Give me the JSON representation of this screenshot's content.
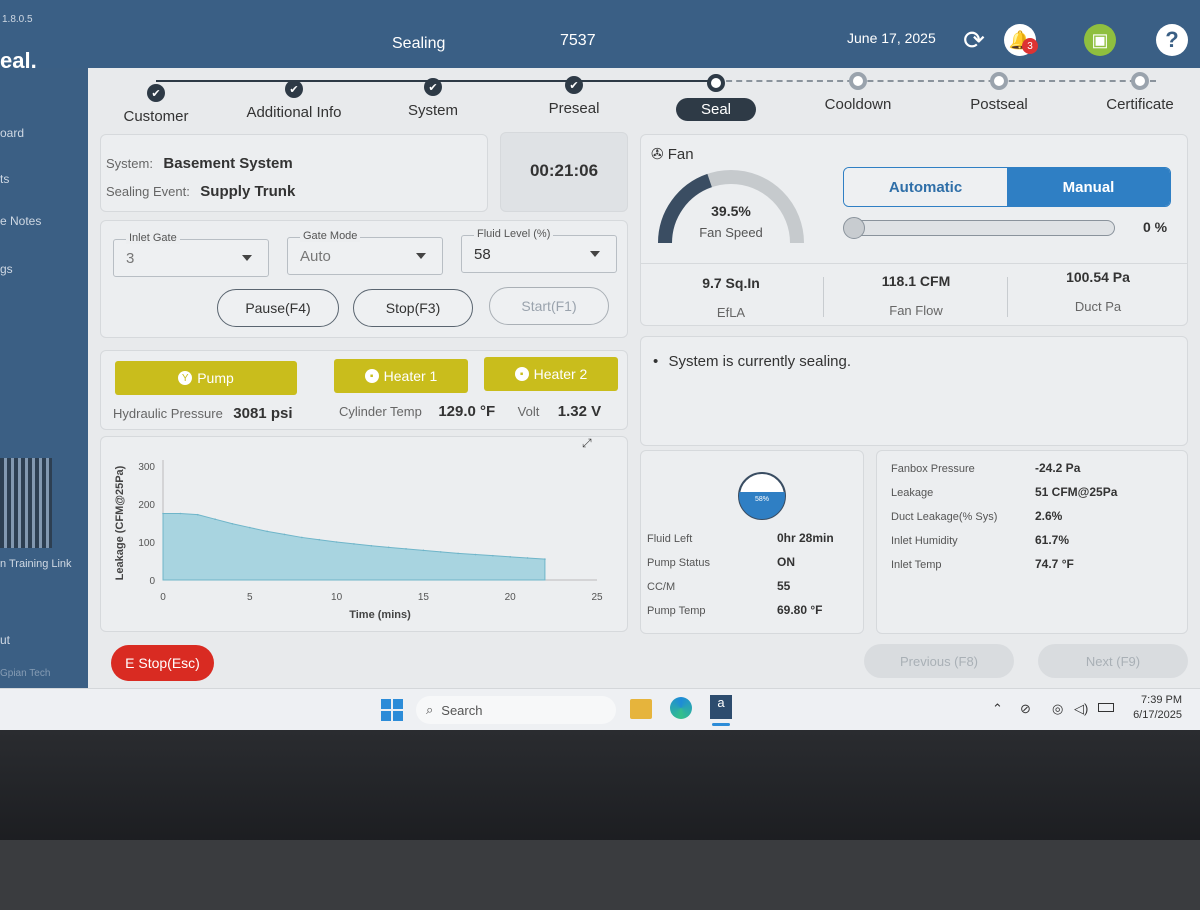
{
  "app": {
    "version": "1.8.0.5",
    "logo": "eal.",
    "title": "Sealing",
    "job_number": "7537",
    "date": "June 17, 2025",
    "alert_count": "3",
    "help": "?"
  },
  "sidebar": {
    "items": [
      "oard",
      "ts",
      "e Notes",
      "gs"
    ],
    "training_link": "n Training Link",
    "bottom": "ut",
    "brand": "Gpian Tech"
  },
  "steps": [
    {
      "label": "Customer",
      "state": "done"
    },
    {
      "label": "Additional Info",
      "state": "done"
    },
    {
      "label": "System",
      "state": "done"
    },
    {
      "label": "Preseal",
      "state": "done"
    },
    {
      "label": "Seal",
      "state": "current"
    },
    {
      "label": "Cooldown",
      "state": "todo"
    },
    {
      "label": "Postseal",
      "state": "todo"
    },
    {
      "label": "Certificate",
      "state": "todo"
    }
  ],
  "system_info": {
    "system_label": "System:",
    "system_value": "Basement System",
    "event_label": "Sealing Event:",
    "event_value": "Supply Trunk"
  },
  "timer": "00:21:06",
  "controls": {
    "inlet_gate": {
      "legend": "Inlet Gate",
      "value": "3"
    },
    "gate_mode": {
      "legend": "Gate Mode",
      "value": "Auto"
    },
    "fluid_level": {
      "legend": "Fluid Level (%)",
      "value": "58"
    },
    "pause": "Pause(F4)",
    "stop": "Stop(F3)",
    "start": "Start(F1)"
  },
  "equipment": {
    "pump": "Pump",
    "heater1": "Heater 1",
    "heater2": "Heater 2",
    "hydraulic_label": "Hydraulic Pressure",
    "hydraulic_value": "3081 psi",
    "cyl_label": "Cylinder Temp",
    "cyl_value": "129.0 °F",
    "volt_label": "Volt",
    "volt_value": "1.32 V"
  },
  "fan": {
    "title": "Fan",
    "speed_value": "39.5%",
    "speed_fraction": 0.395,
    "speed_label": "Fan Speed",
    "mode_automatic": "Automatic",
    "mode_manual": "Manual",
    "manual_percent": "0 %",
    "efla_value": "9.7 Sq.In",
    "efla_label": "EfLA",
    "flow_value": "118.1 CFM",
    "flow_label": "Fan Flow",
    "duct_value": "100.54 Pa",
    "duct_label": "Duct Pa"
  },
  "status_message": "System is currently sealing.",
  "fluid": {
    "tank_percent": "58%",
    "tank_fraction": 0.58,
    "rows": [
      {
        "label": "Fluid Left",
        "value": "0hr 28min"
      },
      {
        "label": "Pump Status",
        "value": "ON"
      },
      {
        "label": "CC/M",
        "value": "55"
      },
      {
        "label": "Pump Temp",
        "value": "69.80 °F"
      }
    ]
  },
  "readings": [
    {
      "label": "Fanbox Pressure",
      "value": "-24.2 Pa"
    },
    {
      "label": "Leakage",
      "value": "51 CFM@25Pa"
    },
    {
      "label": "Duct Leakage(% Sys)",
      "value": "2.6%"
    },
    {
      "label": "Inlet Humidity",
      "value": "61.7%"
    },
    {
      "label": "Inlet Temp",
      "value": "74.7 °F"
    }
  ],
  "chart_data": {
    "type": "area",
    "xlabel": "Time (mins)",
    "ylabel": "Leakage (CFM@25Pa)",
    "xlim": [
      0,
      25
    ],
    "ylim": [
      0,
      300
    ],
    "xticks": [
      "0",
      "5",
      "10",
      "15",
      "20",
      "25"
    ],
    "yticks": [
      "0",
      "100",
      "200",
      "300"
    ],
    "x": [
      0,
      1,
      2,
      3,
      4,
      5,
      6,
      7,
      8,
      9,
      10,
      11,
      12,
      13,
      14,
      15,
      16,
      17,
      18,
      19,
      20,
      21,
      22
    ],
    "y": [
      175,
      175,
      172,
      160,
      148,
      138,
      128,
      120,
      112,
      106,
      100,
      95,
      90,
      86,
      82,
      78,
      74,
      70,
      67,
      64,
      61,
      58,
      55
    ]
  },
  "footer": {
    "estop": "E Stop(Esc)",
    "previous": "Previous (F8)",
    "next": "Next (F9)"
  },
  "taskbar": {
    "search": "Search",
    "time": "7:39 PM",
    "date": "6/17/2025"
  },
  "colors": {
    "header": "#3a5f85",
    "accent_blue": "#2f7fc4",
    "yellow": "#c9bd1c",
    "estop_red": "#d92b22",
    "chart_fill": "#a8d4e0"
  }
}
